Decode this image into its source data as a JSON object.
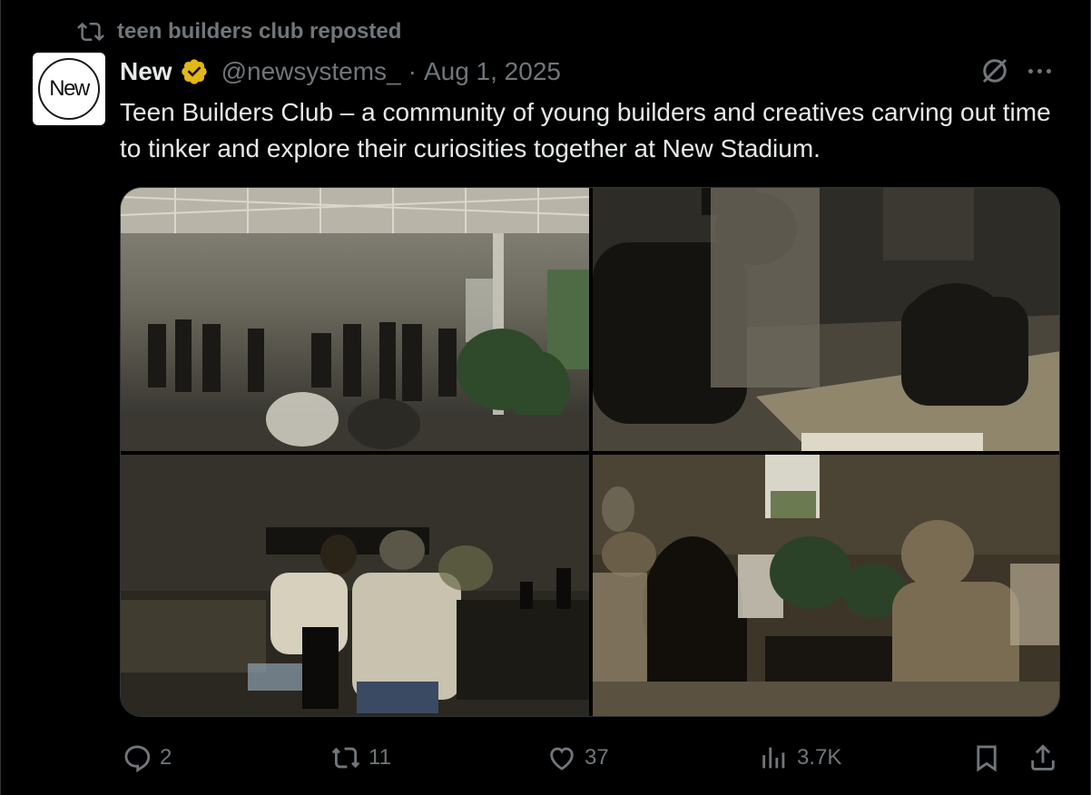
{
  "repost": {
    "label": "teen builders club reposted",
    "icon": "repost-icon"
  },
  "author": {
    "avatar_text": "New",
    "name": "New",
    "verified_color": "#e2b719",
    "handle": "@newsystems_",
    "separator": "·",
    "date": "Aug 1, 2025"
  },
  "tweet": {
    "text": "Teen Builders Club – a community of young builders and creatives carving out time to tinker and explore their curiosities together at New Stadium."
  },
  "media": {
    "photos": [
      {
        "label": "photo-1",
        "scene": "bright studio space with group gathered"
      },
      {
        "label": "photo-2",
        "scene": "people kneeling and writing on floor"
      },
      {
        "label": "photo-3",
        "scene": "two people seated at low table"
      },
      {
        "label": "photo-4",
        "scene": "dim room with group seated around table"
      }
    ]
  },
  "actions": {
    "replies": "2",
    "reposts": "11",
    "likes": "37",
    "views": "3.7K"
  },
  "colors": {
    "background": "#000000",
    "text": "#e7e9ea",
    "muted": "#71767b",
    "border": "#2f3336"
  }
}
